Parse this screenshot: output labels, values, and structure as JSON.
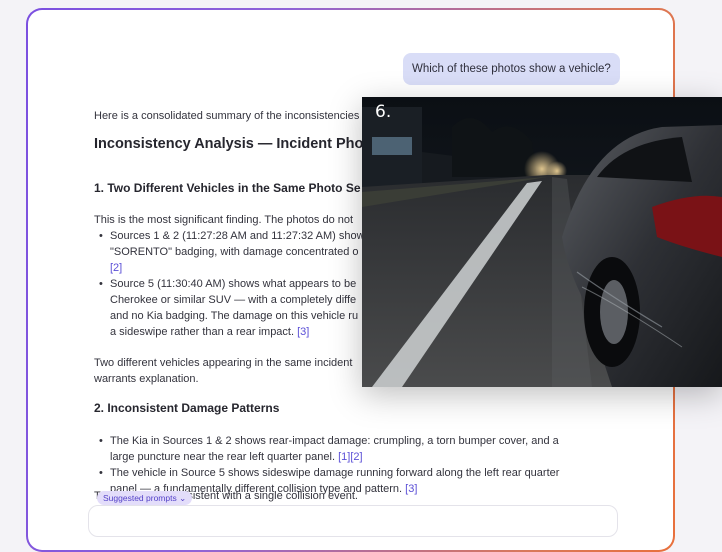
{
  "user_message": "Which of these photos show a vehicle?",
  "response": {
    "intro": "Here is a consolidated summary of the inconsistencies",
    "title": "Inconsistency Analysis — Incident Phot",
    "section1": {
      "heading": "1. Two Different Vehicles in the Same Photo Se",
      "lead": "This is the most significant finding. The photos do not",
      "bullets": [
        {
          "lines": [
            "Sources 1 & 2 (11:27:28 AM and 11:27:32 AM) show",
            "\"SORENTO\" badging, with damage concentrated o"
          ],
          "cite": "[2]"
        },
        {
          "lines": [
            "Source 5 (11:30:40 AM) shows what appears to be",
            "Cherokee or similar SUV — with a completely diffe",
            "and no Kia badging. The damage on this vehicle ru",
            "a sideswipe rather than a rear impact."
          ],
          "cite": "[3]"
        }
      ],
      "closing_1": "Two different vehicles appearing in the same incident",
      "closing_2": "warrants explanation."
    },
    "section2": {
      "heading": "2. Inconsistent Damage Patterns",
      "bullet1_line1": "The Kia in Sources 1 & 2 shows rear-impact damage: crumpling, a torn bumper cover, and a",
      "bullet1_line2": "large puncture near the rear left quarter panel.",
      "bullet1_cite": "[1][2]",
      "bullet2_line1": "The vehicle in Source 5 shows sideswipe damage running forward along the left rear quarter",
      "bullet2_line2": "panel — a fundamentally different collision type and pattern.",
      "bullet2_cite": "[3]",
      "trailing": "T                                profiles are inconsistent with a single collision event."
    }
  },
  "suggested_prompts": {
    "label": "Suggested prompts",
    "icon": "chevron-down-icon"
  },
  "photo_preview": {
    "label": "6."
  }
}
